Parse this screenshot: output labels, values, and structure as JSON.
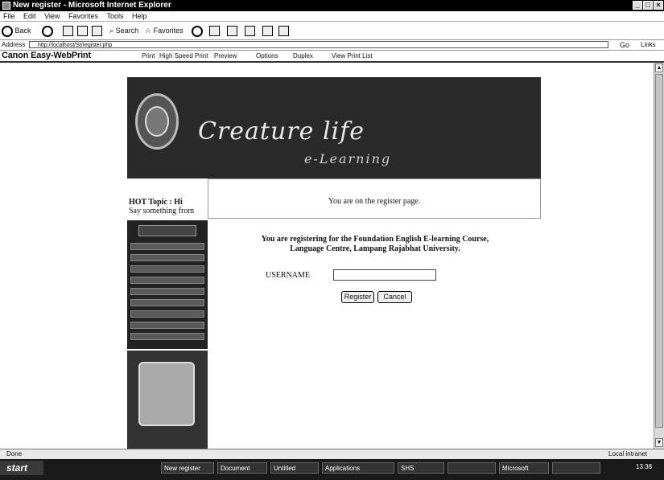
{
  "window": {
    "title": "New register - Microsoft Internet Explorer"
  },
  "menu": [
    "File",
    "Edit",
    "View",
    "Favorites",
    "Tools",
    "Help"
  ],
  "toolbar": {
    "back": "Back",
    "search": "Search",
    "favorites": "Favorites"
  },
  "address": {
    "label": "Address",
    "url": "http://localhost/St/register.php",
    "go": "Go",
    "links": "Links"
  },
  "canon": {
    "brand": "Canon Easy-WebPrint",
    "items": [
      "Print",
      "High Speed Print",
      "Preview",
      "Options",
      "Duplex",
      "View Print List"
    ]
  },
  "banner": {
    "title": "Creature life",
    "subtitle": "e-Learning"
  },
  "sidebar": {
    "hot_topic": "HOT Topic : Hi",
    "hot_sub": "Say something from"
  },
  "message": {
    "text": "You are on the register page."
  },
  "register": {
    "intro_line1": "You are registering for the Foundation English E-learning Course,",
    "intro_line2": "Language Centre, Lampang Rajabhat University.",
    "username_label": "USERNAME",
    "username_value": "",
    "register_label": "Register",
    "cancel_label": "Cancel"
  },
  "status": {
    "done": "Done",
    "zone": "Local intranet"
  },
  "taskbar": {
    "start": "start",
    "tasks": [
      "New register",
      "Document",
      "Untitled",
      "Applications",
      "SHS",
      "",
      "Microsoft",
      ""
    ],
    "clock": "13:38"
  }
}
